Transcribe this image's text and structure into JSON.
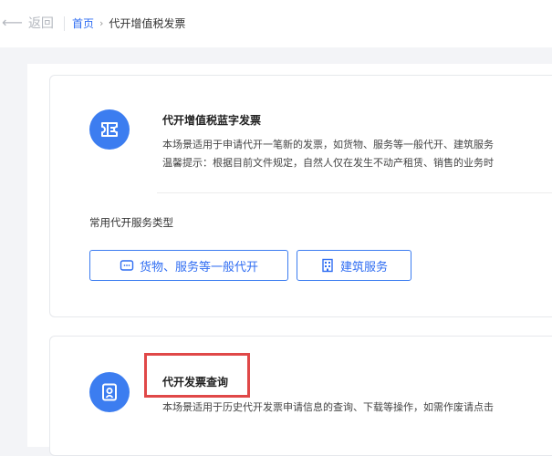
{
  "nav": {
    "back_label": "返回",
    "breadcrumb": {
      "home": "首页",
      "separator": "›",
      "current": "代开增值税发票"
    }
  },
  "card_blue_invoice": {
    "title": "代开增值税蓝字发票",
    "desc_line1": "本场景适用于申请代开一笔新的发票，如货物、服务等一般代开、建筑服务",
    "desc_line2": "温馨提示：根据目前文件规定，自然人仅在发生不动产租赁、销售的业务时",
    "section_label": "常用代开服务类型",
    "buttons": [
      {
        "label": "货物、服务等一般代开",
        "icon": "goods-icon"
      },
      {
        "label": "建筑服务",
        "icon": "building-icon"
      }
    ]
  },
  "card_query": {
    "title": "代开发票查询",
    "desc_line1": "本场景适用于历史代开发票申请信息的查询、下载等操作，如需作废请点击"
  },
  "colors": {
    "accent": "#2f6df2",
    "icon_bg": "#3c7df0",
    "highlight": "#e04848"
  }
}
